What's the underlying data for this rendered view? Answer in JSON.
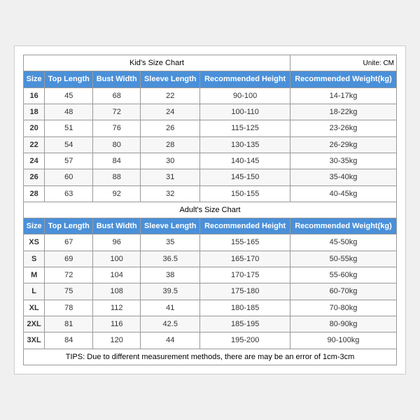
{
  "kids": {
    "title": "Kid's Size Chart",
    "unit": "Unite: CM",
    "headers": [
      "Size",
      "Top Length",
      "Bust Width",
      "Sleeve Length",
      "Recommended Height",
      "Recommended Weight(kg)"
    ],
    "rows": [
      [
        "16",
        "45",
        "68",
        "22",
        "90-100",
        "14-17kg"
      ],
      [
        "18",
        "48",
        "72",
        "24",
        "100-110",
        "18-22kg"
      ],
      [
        "20",
        "51",
        "76",
        "26",
        "115-125",
        "23-26kg"
      ],
      [
        "22",
        "54",
        "80",
        "28",
        "130-135",
        "26-29kg"
      ],
      [
        "24",
        "57",
        "84",
        "30",
        "140-145",
        "30-35kg"
      ],
      [
        "26",
        "60",
        "88",
        "31",
        "145-150",
        "35-40kg"
      ],
      [
        "28",
        "63",
        "92",
        "32",
        "150-155",
        "40-45kg"
      ]
    ]
  },
  "adults": {
    "title": "Adult's Size Chart",
    "headers": [
      "Size",
      "Top Length",
      "Bust Width",
      "Sleeve Length",
      "Recommended Height",
      "Recommended Weight(kg)"
    ],
    "rows": [
      [
        "XS",
        "67",
        "96",
        "35",
        "155-165",
        "45-50kg"
      ],
      [
        "S",
        "69",
        "100",
        "36.5",
        "165-170",
        "50-55kg"
      ],
      [
        "M",
        "72",
        "104",
        "38",
        "170-175",
        "55-60kg"
      ],
      [
        "L",
        "75",
        "108",
        "39.5",
        "175-180",
        "60-70kg"
      ],
      [
        "XL",
        "78",
        "112",
        "41",
        "180-185",
        "70-80kg"
      ],
      [
        "2XL",
        "81",
        "116",
        "42.5",
        "185-195",
        "80-90kg"
      ],
      [
        "3XL",
        "84",
        "120",
        "44",
        "195-200",
        "90-100kg"
      ]
    ]
  },
  "tips": "TIPS: Due to different measurement methods, there are may be an error of 1cm-3cm"
}
